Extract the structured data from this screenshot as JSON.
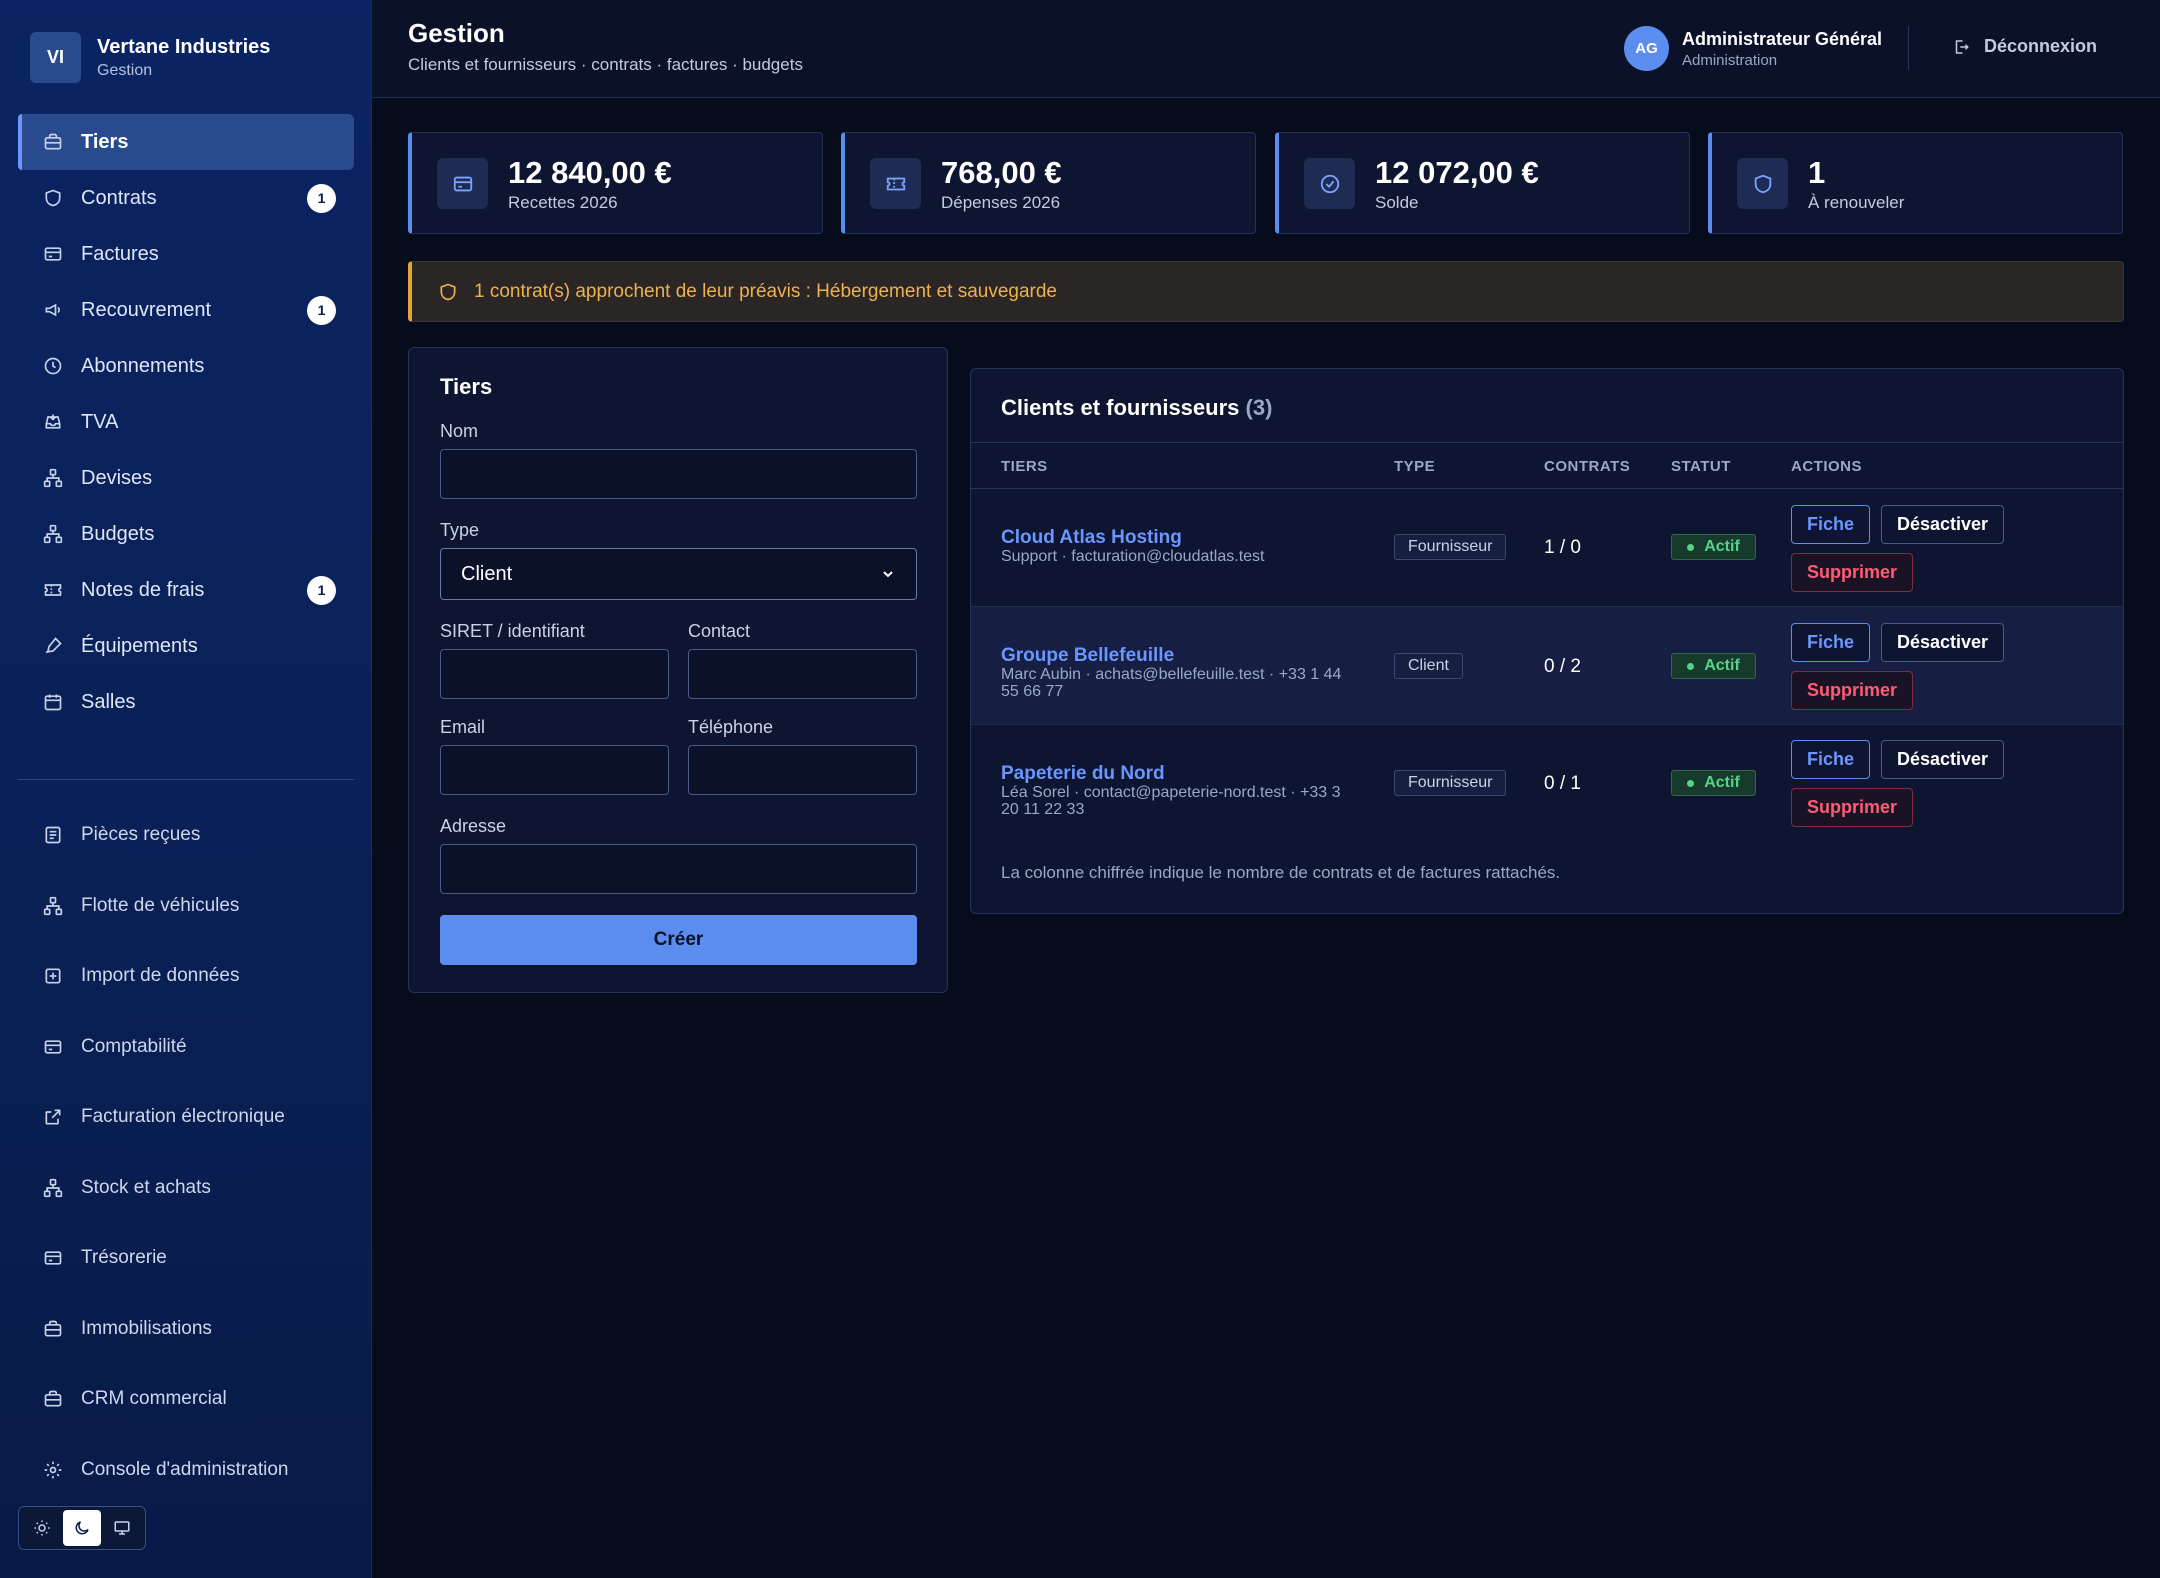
{
  "brand": {
    "logo": "VI",
    "name": "Vertane Industries",
    "subtitle": "Gestion"
  },
  "sidebar": {
    "items": [
      {
        "label": "Tiers",
        "icon": "briefcase-icon",
        "active": true
      },
      {
        "label": "Contrats",
        "icon": "shield-icon",
        "badge": "1"
      },
      {
        "label": "Factures",
        "icon": "credit-card-icon"
      },
      {
        "label": "Recouvrement",
        "icon": "megaphone-icon",
        "badge": "1"
      },
      {
        "label": "Abonnements",
        "icon": "clock-icon"
      },
      {
        "label": "TVA",
        "icon": "inbox-icon"
      },
      {
        "label": "Devises",
        "icon": "network-icon"
      },
      {
        "label": "Budgets",
        "icon": "network-icon"
      },
      {
        "label": "Notes de frais",
        "icon": "ticket-icon",
        "badge": "1"
      },
      {
        "label": "Équipements",
        "icon": "pen-icon"
      },
      {
        "label": "Salles",
        "icon": "calendar-icon"
      }
    ],
    "secondary_items": [
      {
        "label": "Pièces reçues",
        "icon": "document-icon"
      },
      {
        "label": "Flotte de véhicules",
        "icon": "network-icon"
      },
      {
        "label": "Import de données",
        "icon": "plus-square-icon"
      },
      {
        "label": "Comptabilité",
        "icon": "credit-card-icon"
      },
      {
        "label": "Facturation électronique",
        "icon": "external-link-icon"
      },
      {
        "label": "Stock et achats",
        "icon": "network-icon"
      },
      {
        "label": "Trésorerie",
        "icon": "credit-card-icon"
      },
      {
        "label": "Immobilisations",
        "icon": "briefcase-icon"
      },
      {
        "label": "CRM commercial",
        "icon": "briefcase-icon"
      },
      {
        "label": "Console d'administration",
        "icon": "gear-icon"
      }
    ],
    "theme_active": "dark"
  },
  "header": {
    "title": "Gestion",
    "subtitle": "Clients et fournisseurs · contrats · factures · budgets",
    "user_initials": "AG",
    "user_name": "Administrateur Général",
    "user_role": "Administration",
    "logout_label": "Déconnexion"
  },
  "stats": [
    {
      "value": "12 840,00 €",
      "label": "Recettes 2026",
      "icon": "credit-card-icon"
    },
    {
      "value": "768,00 €",
      "label": "Dépenses 2026",
      "icon": "ticket-icon"
    },
    {
      "value": "12 072,00 €",
      "label": "Solde",
      "icon": "check-circle-icon"
    },
    {
      "value": "1",
      "label": "À renouveler",
      "icon": "shield-icon"
    }
  ],
  "alert": {
    "text": "1 contrat(s) approchent de leur préavis : Hébergement et sauvegarde",
    "color": "#f0b04a"
  },
  "form": {
    "title": "Tiers",
    "nom_label": "Nom",
    "nom_value": "",
    "type_label": "Type",
    "type_value": "Client",
    "siret_label": "SIRET / identifiant",
    "siret_value": "",
    "contact_label": "Contact",
    "contact_value": "",
    "email_label": "Email",
    "email_value": "",
    "telephone_label": "Téléphone",
    "telephone_value": "",
    "adresse_label": "Adresse",
    "adresse_value": "",
    "submit_label": "Créer"
  },
  "table": {
    "title": "Clients et fournisseurs",
    "count": "(3)",
    "columns": [
      "TIERS",
      "TYPE",
      "CONTRATS",
      "STATUT",
      "ACTIONS"
    ],
    "rows": [
      {
        "name": "Cloud Atlas Hosting",
        "sub": "Support · facturation@cloudatlas.test",
        "type": "Fournisseur",
        "contracts": "1 / 0",
        "status": "Actif",
        "actions": [
          "Fiche",
          "Désactiver",
          "Supprimer"
        ]
      },
      {
        "name": "Groupe Bellefeuille",
        "sub": "Marc Aubin · achats@bellefeuille.test · +33 1 44 55 66 77",
        "type": "Client",
        "contracts": "0 / 2",
        "status": "Actif",
        "actions": [
          "Fiche",
          "Désactiver",
          "Supprimer"
        ]
      },
      {
        "name": "Papeterie du Nord",
        "sub": "Léa Sorel · contact@papeterie-nord.test · +33 3 20 11 22 33",
        "type": "Fournisseur",
        "contracts": "0 / 1",
        "status": "Actif",
        "actions": [
          "Fiche",
          "Désactiver",
          "Supprimer"
        ]
      }
    ],
    "note": "La colonne chiffrée indique le nombre de contrats et de factures rattachés."
  },
  "colors": {
    "accent": "#5b8def",
    "sidebar_bg": "#0a2463",
    "page_bg": "#070c1d",
    "success": "#55d38a",
    "danger": "#ff5b73",
    "warning": "#e8a33c"
  }
}
